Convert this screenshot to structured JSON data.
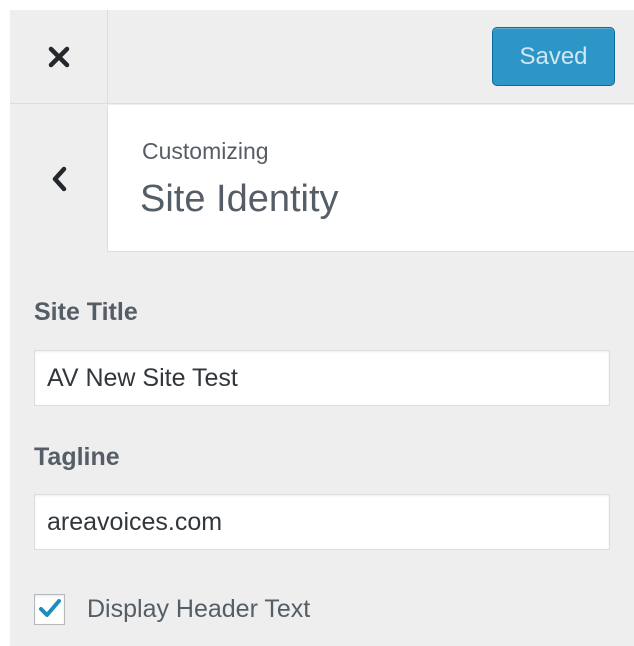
{
  "header": {
    "close_icon": "close-x-icon",
    "save_label": "Saved",
    "save_color": "#2e95c7"
  },
  "section": {
    "back_icon": "chevron-left-icon",
    "eyebrow": "Customizing",
    "title": "Site Identity"
  },
  "form": {
    "site_title": {
      "label": "Site Title",
      "value": "AV New Site Test"
    },
    "tagline": {
      "label": "Tagline",
      "value": "areavoices.com"
    },
    "display_header_text": {
      "label": "Display Header Text",
      "checked": true,
      "check_color": "#1e8cbe"
    }
  }
}
